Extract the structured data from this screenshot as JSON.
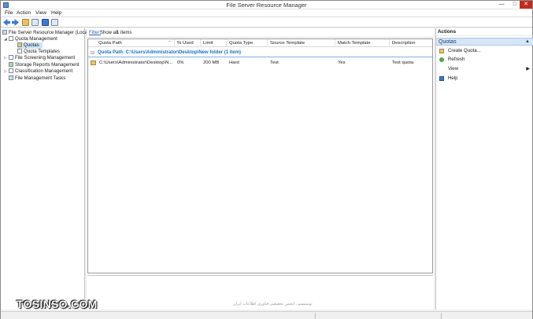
{
  "window": {
    "title": "File Server Resource Manager"
  },
  "menu": [
    "File",
    "Action",
    "View",
    "Help"
  ],
  "tree": {
    "root": "File Server Resource Manager (Local)",
    "quota_management": "Quota Management",
    "quotas": "Quotas",
    "quota_templates": "Quota Templates",
    "file_screening": "File Screening Management",
    "storage_reports": "Storage Reports Management",
    "classification": "Classification Management",
    "file_tasks": "File Management Tasks"
  },
  "filter": {
    "label": "Filter:",
    "value": "Show all",
    "count": "1 items"
  },
  "table": {
    "columns": [
      "Quota Path",
      "% Used",
      "Limit",
      "Quota Type",
      "Source Template",
      "Match Template",
      "Description"
    ],
    "group": "Quota Path: C:\\Users\\Administrator\\Desktop\\New folder (1 item)",
    "rows": [
      {
        "path": "C:\\Users\\Administrator\\Desktop\\N...",
        "used": "0%",
        "limit": "200 MB",
        "type": "Hard",
        "source": "Test",
        "match": "Yes",
        "description": "Test quota"
      }
    ]
  },
  "actions": {
    "header": "Actions",
    "section": "Quotas",
    "items": {
      "create": "Create Quota...",
      "refresh": "Refresh",
      "view": "View",
      "help": "Help"
    }
  },
  "watermark": {
    "text": "TOSINSO.COM",
    "persian": "توسینسو ، انجمن تخصصی فناوری اطلاعات ایران"
  },
  "colors": {
    "accent": "#1c6fc4",
    "section_bg": "#d6e6f5",
    "selection": "#cce4f7"
  }
}
